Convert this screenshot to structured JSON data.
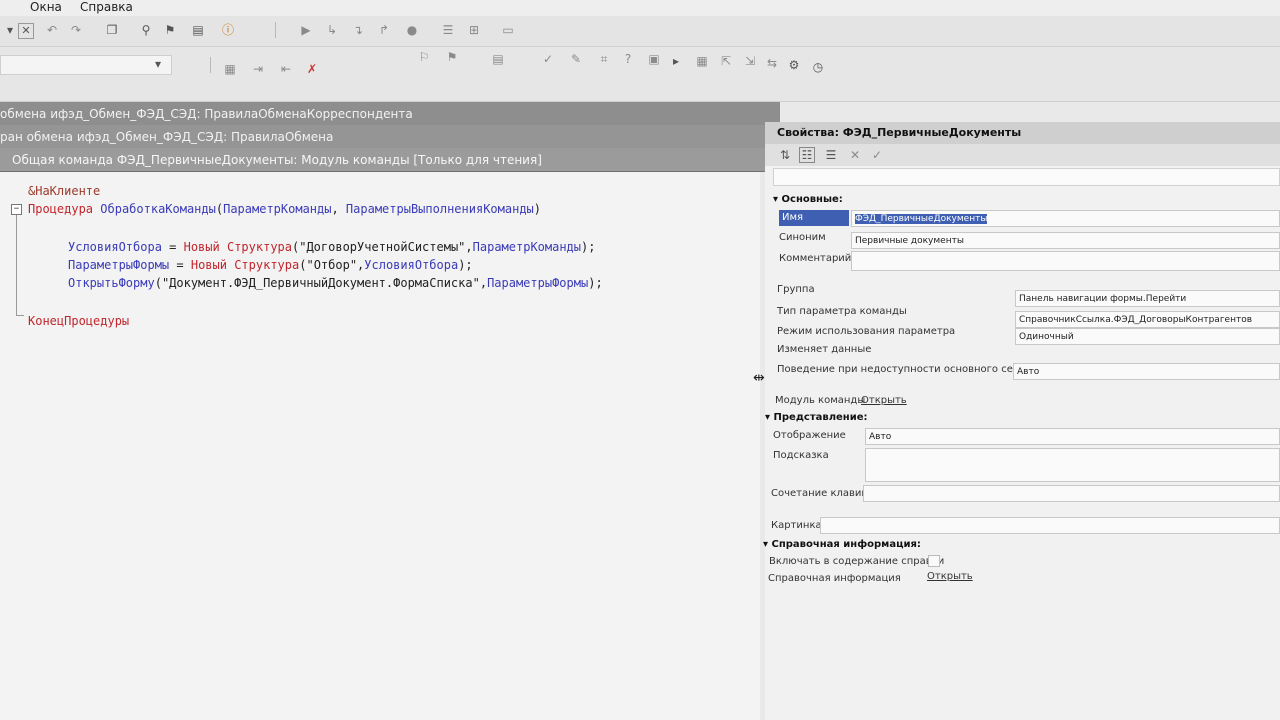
{
  "menubar": {
    "items": [
      "Окна",
      "Справка"
    ]
  },
  "window_tabs": [
    "обмена ифэд_Обмен_ФЭД_СЭД: ПравилаОбменаКорреспондента",
    "ран обмена ифэд_Обмен_ФЭД_СЭД: ПравилаОбмена",
    "Общая команда ФЭД_ПервичныеДокументы: Модуль команды [Только для чтения]"
  ],
  "code": {
    "directive": "&НаКлиенте",
    "proc_kw": "Процедура",
    "proc_name": "ОбработкаКоманды",
    "param1": "ПараметрКоманды",
    "param2": "ПараметрыВыполненияКоманды",
    "l1_var": "УсловияОтбора",
    "l1_new": "Новый",
    "l1_type": "Структура",
    "l1_str": "\"ДоговорУчетнойСистемы\"",
    "l1_arg": "ПараметрКоманды",
    "l2_var": "ПараметрыФормы",
    "l2_new": "Новый",
    "l2_type": "Структура",
    "l2_str": "\"Отбор\"",
    "l2_arg": "УсловияОтбора",
    "l3_fn": "ОткрытьФорму",
    "l3_str": "\"Документ.ФЭД_ПервичныйДокумент.ФормаСписка\"",
    "l3_arg": "ПараметрыФормы",
    "end_kw": "КонецПроцедуры"
  },
  "properties": {
    "title": "Свойства: ФЭД_ПервичныеДокументы",
    "sections": {
      "main": "Основные:",
      "view": "Представление:",
      "help": "Справочная информация:"
    },
    "fields": {
      "name_label": "Имя",
      "name_value": "ФЭД_ПервичныеДокументы",
      "synonym_label": "Синоним",
      "synonym_value": "Первичные документы",
      "comment_label": "Комментарий",
      "group_label": "Группа",
      "group_value": "Панель навигации формы.Перейти",
      "param_type_label": "Тип параметра команды",
      "param_type_value": "СправочникСсылка.ФЭД_ДоговорыКонтрагентов",
      "param_mode_label": "Режим использования параметра",
      "param_mode_value": "Одиночный",
      "changes_data_label": "Изменяет данные",
      "server_behavior_label": "Поведение при недоступности основного сервера",
      "server_behavior_value": "Авто",
      "module_label": "Модуль команды",
      "module_link": "Открыть",
      "display_label": "Отображение",
      "display_value": "Авто",
      "tooltip_label": "Подсказка",
      "shortcut_label": "Сочетание клавиш",
      "picture_label": "Картинка",
      "include_help_label": "Включать в содержание справки",
      "help_info_label": "Справочная информация",
      "help_info_link": "Открыть"
    }
  }
}
